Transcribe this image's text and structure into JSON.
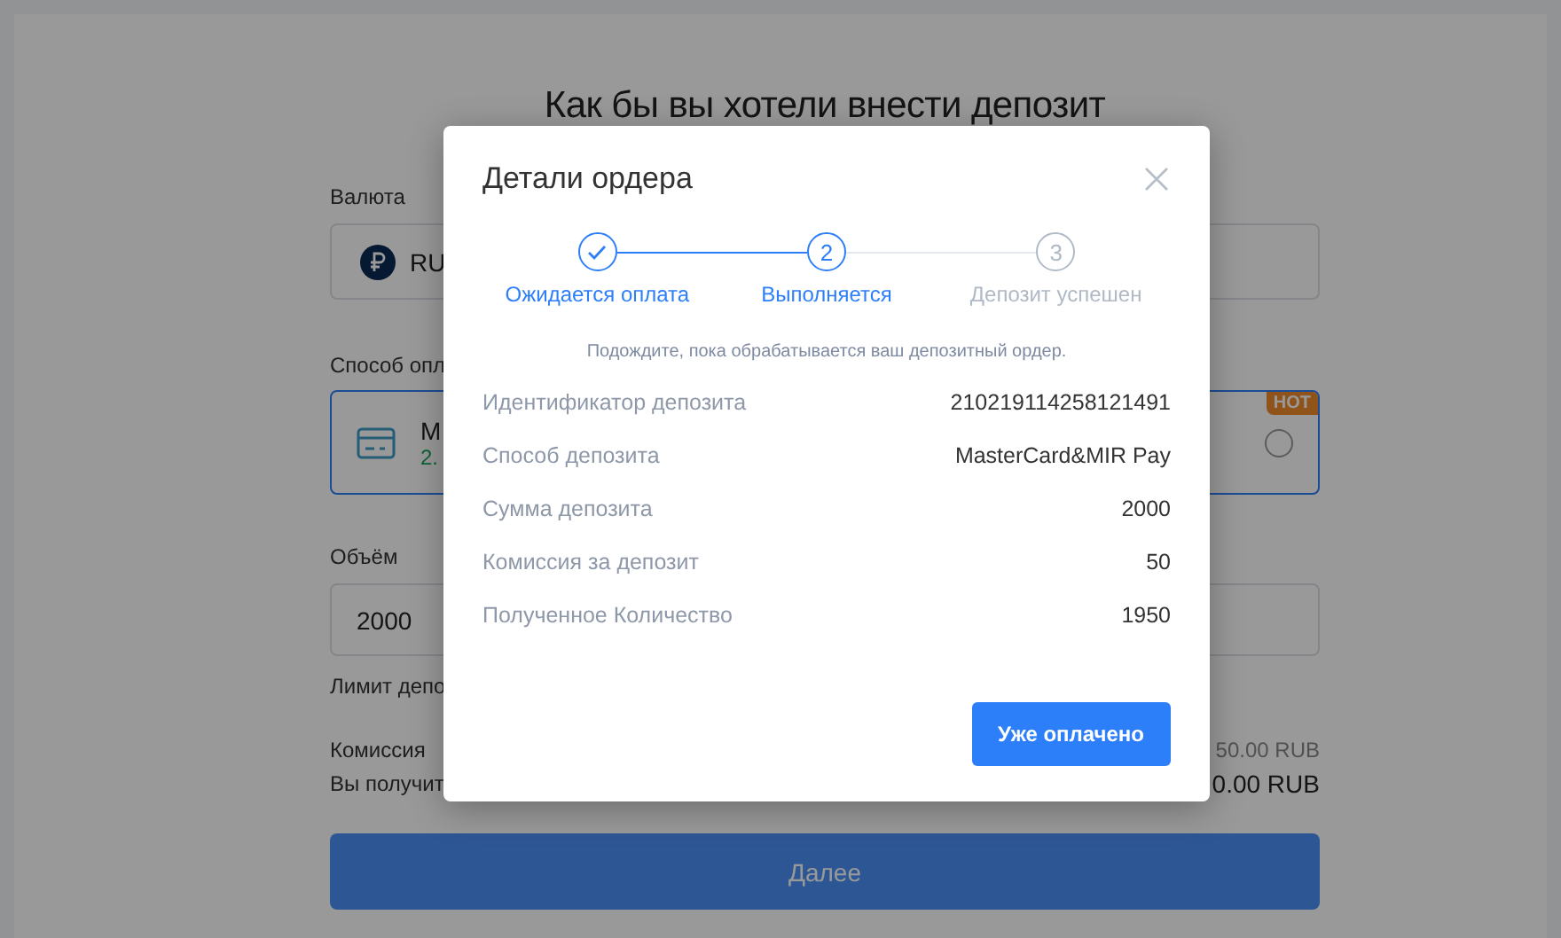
{
  "page": {
    "title": "Как бы вы хотели внести депозит",
    "currency": {
      "label": "Валюта",
      "value": "RU"
    },
    "method": {
      "label": "Способ опл",
      "option": {
        "name": "M",
        "sub": "2.",
        "badge": "HOT",
        "selected": true
      }
    },
    "amount": {
      "label": "Объём",
      "value": "2000",
      "limit": "Лимит депо"
    },
    "fee": {
      "label": "Комиссия",
      "value": "50.00 RUB"
    },
    "receive": {
      "label": "Вы получит",
      "value": "0.00 RUB"
    },
    "next_button": "Далее"
  },
  "modal": {
    "title": "Детали ордера",
    "steps": [
      {
        "label": "Ожидается оплата",
        "kind": "done"
      },
      {
        "number": "2",
        "label": "Выполняется",
        "kind": "active"
      },
      {
        "number": "3",
        "label": "Депозит успешен",
        "kind": "pending"
      }
    ],
    "note": "Подождите, пока обрабатывается ваш депозитный ордер.",
    "details": [
      {
        "label": "Идентификатор депозита",
        "value": "210219114258121491"
      },
      {
        "label": "Способ депозита",
        "value": "MasterCard&MIR Pay"
      },
      {
        "label": "Сумма депозита",
        "value": "2000"
      },
      {
        "label": "Комиссия за депозит",
        "value": "50"
      },
      {
        "label": "Полученное Количество",
        "value": "1950"
      }
    ],
    "button": "Уже оплачено"
  }
}
